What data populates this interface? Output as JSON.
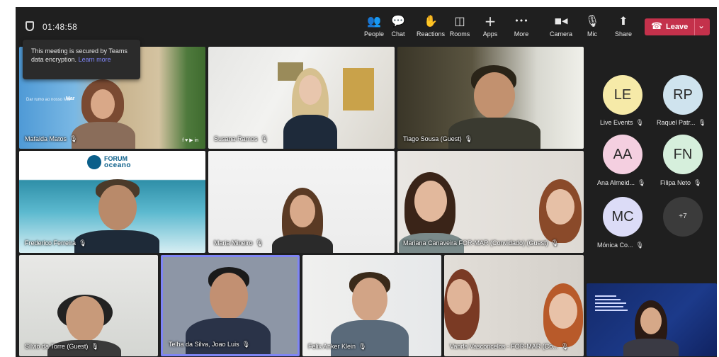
{
  "meeting": {
    "timer": "01:48:58",
    "tooltip": {
      "text": "This meeting is secured by Teams data encryption.",
      "link": "Learn more"
    }
  },
  "toolbar": {
    "items": [
      {
        "label": "People",
        "icon": "people-icon",
        "glyph": "👥"
      },
      {
        "label": "Chat",
        "icon": "chat-icon",
        "glyph": "💬"
      },
      {
        "label": "Reactions",
        "icon": "reactions-icon",
        "glyph": "✋"
      },
      {
        "label": "Rooms",
        "icon": "rooms-icon",
        "glyph": "◫"
      },
      {
        "label": "Apps",
        "icon": "apps-icon",
        "glyph": "+"
      },
      {
        "label": "More",
        "icon": "more-icon",
        "glyph": "•••"
      },
      {
        "label": "Camera",
        "icon": "camera-icon",
        "glyph": "■◀"
      },
      {
        "label": "Mic",
        "icon": "mic-off-icon",
        "glyph": "🎙"
      },
      {
        "label": "Share",
        "icon": "share-icon",
        "glyph": "⬆"
      }
    ],
    "leave_label": "Leave"
  },
  "tiles": [
    {
      "name": "Mafalda Matos",
      "overlay": "Dar rumo ao nosso Mar",
      "overlay_brand": "Mar"
    },
    {
      "name": "Susana Ramos"
    },
    {
      "name": "Tiago Sousa (Guest)"
    },
    {
      "name": "Frederico Ferreira",
      "logo_line1": "FORUM",
      "logo_line2": "oceano"
    },
    {
      "name": "Maria Mineiro"
    },
    {
      "name": "Mariana Canaveira FOR-MAR (Convidado) (Guest)"
    },
    {
      "name": "Silvio da Torre (Guest)"
    },
    {
      "name": "Telha da Silva, Joao Luis"
    },
    {
      "name": "Felix Anker Klein"
    },
    {
      "name": "Vanda Vasconcelos - FOR-MAR (Co..."
    }
  ],
  "panel": {
    "participants": [
      {
        "initials": "LE",
        "name": "Live Events",
        "color": "#f6eaa8"
      },
      {
        "initials": "RP",
        "name": "Raquel Patr...",
        "color": "#cfe3ee"
      },
      {
        "initials": "AA",
        "name": "Ana Almeid...",
        "color": "#f4cfe0"
      },
      {
        "initials": "FN",
        "name": "Filipa Neto",
        "color": "#d6efdc"
      },
      {
        "initials": "MC",
        "name": "Mónica Co...",
        "color": "#dcdcf7"
      }
    ],
    "more_count": "+7"
  },
  "colors": {
    "background": "#1f1f1f",
    "leave": "#c4314b",
    "active_speaker_border": "#7f85f5",
    "link": "#7f85f5"
  }
}
